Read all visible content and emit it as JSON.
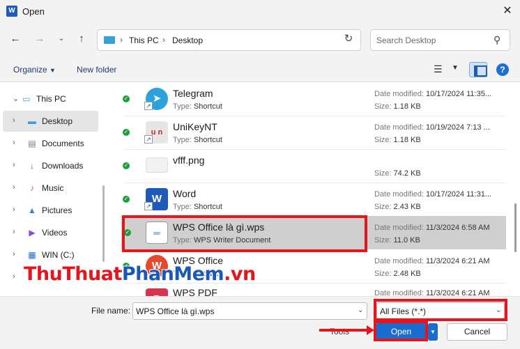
{
  "window": {
    "title": "Open",
    "app_icon": "word-app-icon"
  },
  "navigation": {
    "breadcrumbs": [
      "This PC",
      "Desktop"
    ],
    "search_placeholder": "Search Desktop"
  },
  "toolbar": {
    "organize": "Organize",
    "new_folder": "New folder"
  },
  "sidebar": {
    "items": [
      {
        "label": "This PC",
        "icon": "computer-icon"
      },
      {
        "label": "Desktop",
        "icon": "desktop-icon",
        "selected": true
      },
      {
        "label": "Documents",
        "icon": "documents-icon"
      },
      {
        "label": "Downloads",
        "icon": "downloads-icon"
      },
      {
        "label": "Music",
        "icon": "music-icon"
      },
      {
        "label": "Pictures",
        "icon": "pictures-icon"
      },
      {
        "label": "Videos",
        "icon": "videos-icon"
      },
      {
        "label": "WIN (C:)",
        "icon": "drive-icon"
      }
    ]
  },
  "labels": {
    "type": "Type:",
    "date_modified": "Date modified:",
    "size": "Size:"
  },
  "files": [
    {
      "name": "Telegram",
      "type": "Shortcut",
      "modified": "10/17/2024 11:35...",
      "size": "1.18 KB",
      "icon": "telegram-icon",
      "color": "#2aa3dc"
    },
    {
      "name": "UniKeyNT",
      "type": "Shortcut",
      "modified": "10/19/2024 7:13 ...",
      "size": "1.18 KB",
      "icon": "unikey-icon",
      "color": "#d9d9d9"
    },
    {
      "name": "vfff.png",
      "type": "",
      "modified": "",
      "size": "74.2 KB",
      "icon": "image-file-icon",
      "color": "#eeeeee"
    },
    {
      "name": "Word",
      "type": "Shortcut",
      "modified": "10/17/2024 11:31...",
      "size": "2.43 KB",
      "icon": "word-icon",
      "color": "#1e5bb8"
    },
    {
      "name": "WPS Office là gì.wps",
      "type": "WPS Writer Document",
      "modified": "11/3/2024 6:58 AM",
      "size": "11.0 KB",
      "icon": "wps-document-icon",
      "color": "#ffffff",
      "selected": true
    },
    {
      "name": "WPS Office",
      "type": "Shortcut",
      "modified": "11/3/2024 6:21 AM",
      "size": "2.48 KB",
      "icon": "wps-office-icon",
      "color": "#e8472c"
    },
    {
      "name": "WPS PDF",
      "type": "",
      "modified": "11/3/2024 6:21 AM",
      "size": "",
      "icon": "wps-pdf-icon",
      "color": "#d8324e"
    }
  ],
  "footer": {
    "file_name_label": "File name:",
    "file_name_value": "WPS Office là gì.wps",
    "filter_value": "All Files (*.*)",
    "tools_label": "Tools",
    "open_label": "Open",
    "cancel_label": "Cancel"
  },
  "watermark": {
    "part1": "ThuThuat",
    "part2": "PhanMem",
    "part3": ".vn"
  },
  "colors": {
    "accent": "#1a6ccf",
    "highlight": "#e8141b",
    "selected_row": "#cfcfcf"
  }
}
